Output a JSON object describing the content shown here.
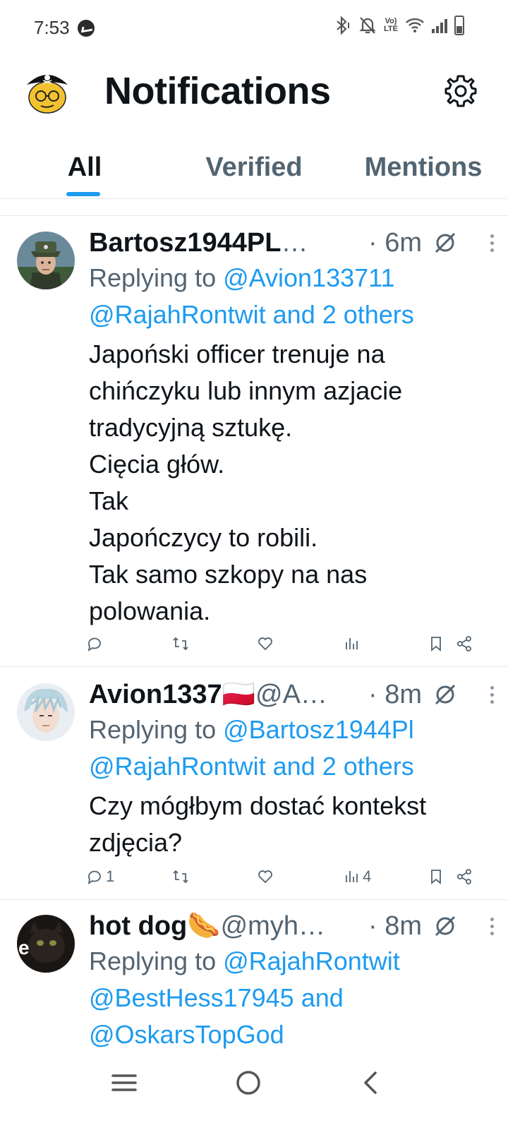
{
  "status_bar": {
    "time": "7:53",
    "icons": [
      "messenger-icon",
      "bluetooth-icon",
      "mute-icon",
      "volte-icon",
      "wifi-icon",
      "signal-icon",
      "battery-icon"
    ],
    "volte_label_top": "Vo)",
    "volte_label_bottom": "LTE"
  },
  "header": {
    "title": "Notifications",
    "settings_icon": "gear-icon"
  },
  "tabs": [
    {
      "label": "All",
      "active": true
    },
    {
      "label": "Verified",
      "active": false
    },
    {
      "label": "Mentions",
      "active": false
    }
  ],
  "posts": [
    {
      "display_name": "Bartosz1944PL",
      "handle": " …",
      "time": "· 6m",
      "replying_prefix": "Replying to ",
      "replying_line1": "@Avion133711",
      "replying_line2": "@RajahRontwit and 2 others",
      "text": "Japoński officer trenuje na\nchińczyku lub innym azjacie\ntradycyjną sztukę.\nCięcia głów.\nTak\nJapończycy to robili.\nTak samo szkopy na nas\npolowania.",
      "replies": "",
      "views": ""
    },
    {
      "display_name": "Avion1337🇵🇱",
      "handle": " @A…",
      "time": "· 8m",
      "replying_prefix": "Replying to ",
      "replying_line1": "@Bartosz1944Pl",
      "replying_line2": "@RajahRontwit and 2 others",
      "text": "Czy mógłbym dostać kontekst\nzdjęcia?",
      "replies": "1",
      "views": "4"
    },
    {
      "display_name": "hot dog🌭",
      "handle": " @myh…",
      "time": "· 8m",
      "replying_prefix": "Replying to ",
      "replying_line1": "@RajahRontwit",
      "replying_line2": "@BestHess17945 and",
      "replying_line3": "@OskarsTopGod"
    }
  ],
  "colors": {
    "accent": "#1d9bf0",
    "text": "#0f1419",
    "muted": "#536471",
    "divider": "#e6e9ec"
  },
  "nav_icons": [
    "recent-apps-icon",
    "home-icon",
    "back-icon"
  ]
}
